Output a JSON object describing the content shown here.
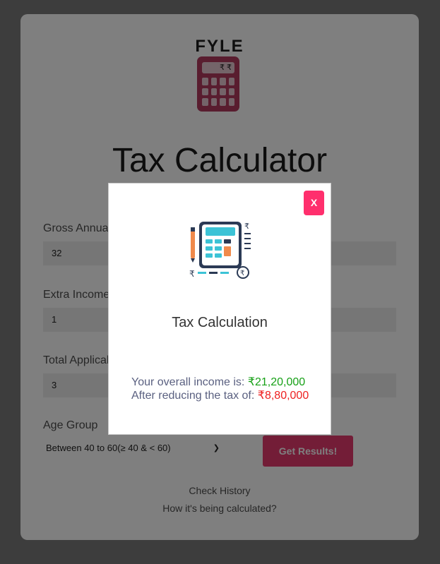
{
  "logo": {
    "text": "FYLE",
    "screen_symbol": "₹ ₹"
  },
  "title": "Tax Calculator",
  "form": {
    "gross_label": "Gross Annual Income",
    "gross_value": "32",
    "extra_label": "Extra Income",
    "extra_value": "1",
    "deductions_label": "Total Applicable Deductions",
    "deductions_value": "3",
    "age_label": "Age Group",
    "age_selected": "Between 40 to 60(≥ 40 & < 60)",
    "submit_label": "Get Results!"
  },
  "links": {
    "history": "Check History",
    "how": "How it's being calculated?"
  },
  "modal": {
    "close_label": "X",
    "title": "Tax Calculation",
    "income_prefix": "Your overall income is: ",
    "income_value": "₹21,20,000",
    "tax_prefix": "After reducing the tax of: ",
    "tax_value": "₹8,80,000"
  },
  "colors": {
    "accent": "#e63b6f",
    "close_button": "#ff2f6d",
    "income_value": "#16a016",
    "tax_value": "#ee2020"
  },
  "icons": [
    "calculator-logo-icon",
    "chevron-down-icon",
    "calculator-tax-icon"
  ]
}
